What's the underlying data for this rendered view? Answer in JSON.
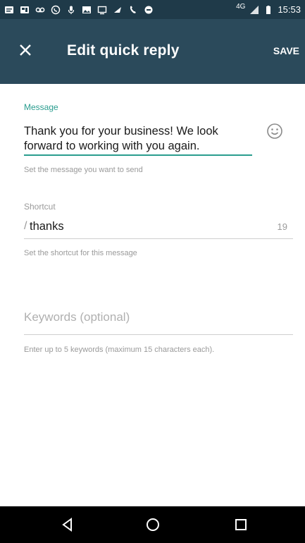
{
  "status_bar": {
    "network": "4G",
    "time": "15:53",
    "icons": [
      "message-icon",
      "gallery-icon",
      "voicemail-icon",
      "whatsapp-icon",
      "mic-icon",
      "image-icon",
      "cast-icon",
      "location-icon",
      "missed-call-icon",
      "blocked-icon",
      "signal-icon",
      "battery-icon"
    ]
  },
  "app_bar": {
    "title": "Edit quick reply",
    "save_label": "SAVE",
    "close_icon": "close-icon"
  },
  "message": {
    "label": "Message",
    "value": "Thank you for your business! We look forward to working with you again.",
    "helper": "Set the message you want to send",
    "emoji_icon": "emoji-icon"
  },
  "shortcut": {
    "label": "Shortcut",
    "prefix": "/",
    "value": "thanks",
    "count": "19",
    "helper": "Set the shortcut for this message"
  },
  "keywords": {
    "placeholder": "Keywords (optional)",
    "helper": "Enter up to 5 keywords (maximum 15 characters each)."
  },
  "nav": {
    "back_icon": "back-icon",
    "home_icon": "home-icon",
    "recents_icon": "recents-icon"
  },
  "colors": {
    "status_bar": "#1f3a49",
    "app_bar": "#2b4a5b",
    "accent": "#2a9d8f"
  }
}
